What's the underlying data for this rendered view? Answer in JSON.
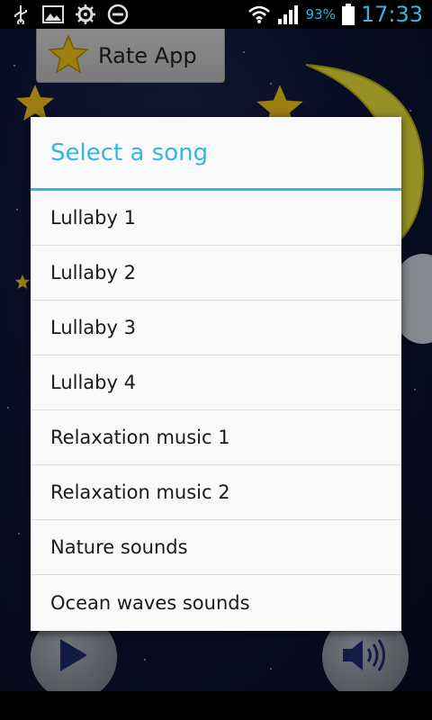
{
  "status_bar": {
    "battery_percent": "93%",
    "time": "17:33",
    "icons": [
      "usb-icon",
      "image-icon",
      "settings-gear-icon",
      "do-not-disturb-icon",
      "wifi-icon",
      "signal-icon",
      "battery-icon"
    ]
  },
  "app": {
    "rate_button_label": "Rate App",
    "play_icon": "play-icon",
    "volume_icon": "volume-icon"
  },
  "dialog": {
    "title": "Select a song",
    "items": [
      "Lullaby 1",
      "Lullaby 2",
      "Lullaby 3",
      "Lullaby 4",
      "Relaxation music 1",
      "Relaxation music 2",
      "Nature sounds",
      "Ocean waves sounds"
    ]
  },
  "colors": {
    "accent": "#33b5e5",
    "dialog_bg": "#fafafa",
    "background_night": "#0f1538"
  }
}
